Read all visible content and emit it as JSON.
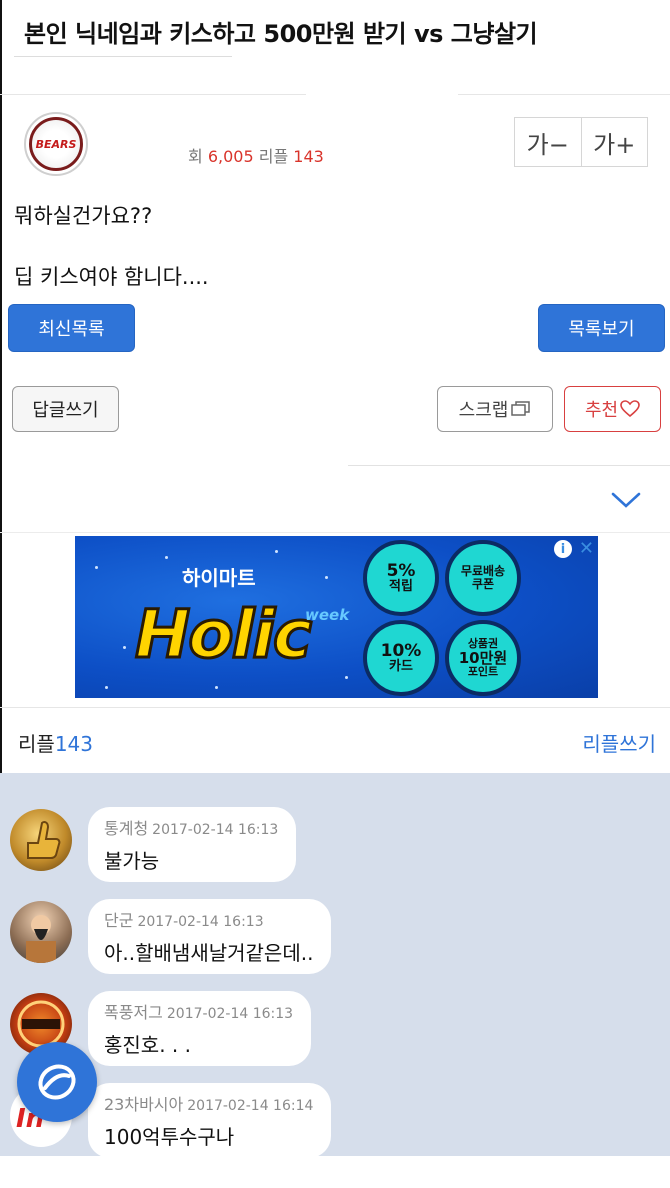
{
  "post": {
    "title": "본인 닉네임과 키스하고 500만원 받기 vs 그냥살기",
    "avatar_text": "BEARS",
    "views_label": "회",
    "views_value": "6,005",
    "replies_label": "리플",
    "replies_value": "143",
    "font_minus_label": "가−",
    "font_plus_label": "가+",
    "body_lines": [
      "뭐하실건가요??",
      "딥 키스여야 함니다...."
    ]
  },
  "buttons": {
    "latest_list": "최신목록",
    "view_list": "목록보기",
    "write_reply": "답글쓰기",
    "scrap": "스크랩",
    "recommend": "추천"
  },
  "ad": {
    "brand": "하이마트",
    "headline": "Holic",
    "tag": "week",
    "coin1_big": "5%",
    "coin1_small": "적립",
    "coin2_top": "무료배송",
    "coin2_bottom": "쿠폰",
    "coin3_big": "10%",
    "coin3_small": "카드",
    "coin4_top": "상품권",
    "coin4_mid": "10만원",
    "coin4_bottom": "포인트"
  },
  "replies": {
    "label": "리플",
    "count": "143",
    "write_label": "리플쓰기"
  },
  "comments": [
    {
      "author": "통계청",
      "date": "2017-02-14 16:13",
      "text": "불가능"
    },
    {
      "author": "단군",
      "date": "2017-02-14 16:13",
      "text": "아..할배냄새날거같은데.."
    },
    {
      "author": "폭풍저그",
      "date": "2017-02-14 16:13",
      "text": "홍진호. . ."
    },
    {
      "author": "23차바시아",
      "date": "2017-02-14 16:14",
      "text": "100억투수구나"
    }
  ],
  "colors": {
    "accent_blue": "#2f74d8",
    "stat_red": "#d9342b",
    "comment_bg": "#d6deeb"
  }
}
